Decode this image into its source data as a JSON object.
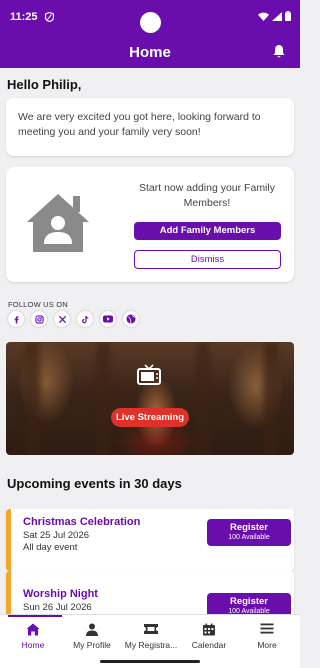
{
  "status_bar": {
    "time": "11:25"
  },
  "header": {
    "title": "Home"
  },
  "greeting": "Hello Philip,",
  "welcome_message": "We are very excited you got here, looking forward to meeting you and your family very soon!",
  "family_card": {
    "message": "Start now adding your Family Members!",
    "add_label": "Add Family Members",
    "dismiss_label": "Dismiss"
  },
  "social": {
    "label": "FOLLOW US ON",
    "icons": [
      "facebook-icon",
      "instagram-icon",
      "x-icon",
      "tiktok-icon",
      "youtube-icon",
      "globe-icon"
    ]
  },
  "live": {
    "label": "Live Streaming"
  },
  "events": {
    "title": "Upcoming events in 30 days",
    "items": [
      {
        "name": "Christmas Celebration",
        "date": "Sat 25 Jul  2026",
        "time": "All day event",
        "register_label": "Register",
        "availability": "100 Available"
      },
      {
        "name": "Worship Night",
        "date": "Sun 26 Jul  2026",
        "time": "",
        "register_label": "Register",
        "availability": "100 Available"
      }
    ]
  },
  "nav": {
    "items": [
      {
        "label": "Home",
        "icon": "home-icon",
        "active": true
      },
      {
        "label": "My Profile",
        "icon": "person-icon",
        "active": false
      },
      {
        "label": "My Registra...",
        "icon": "ticket-icon",
        "active": false
      },
      {
        "label": "Calendar",
        "icon": "calendar-icon",
        "active": false
      },
      {
        "label": "More",
        "icon": "menu-icon",
        "active": false
      }
    ]
  },
  "colors": {
    "primary": "#6a0dad",
    "accent": "#f5a623",
    "live": "#e0302a"
  }
}
